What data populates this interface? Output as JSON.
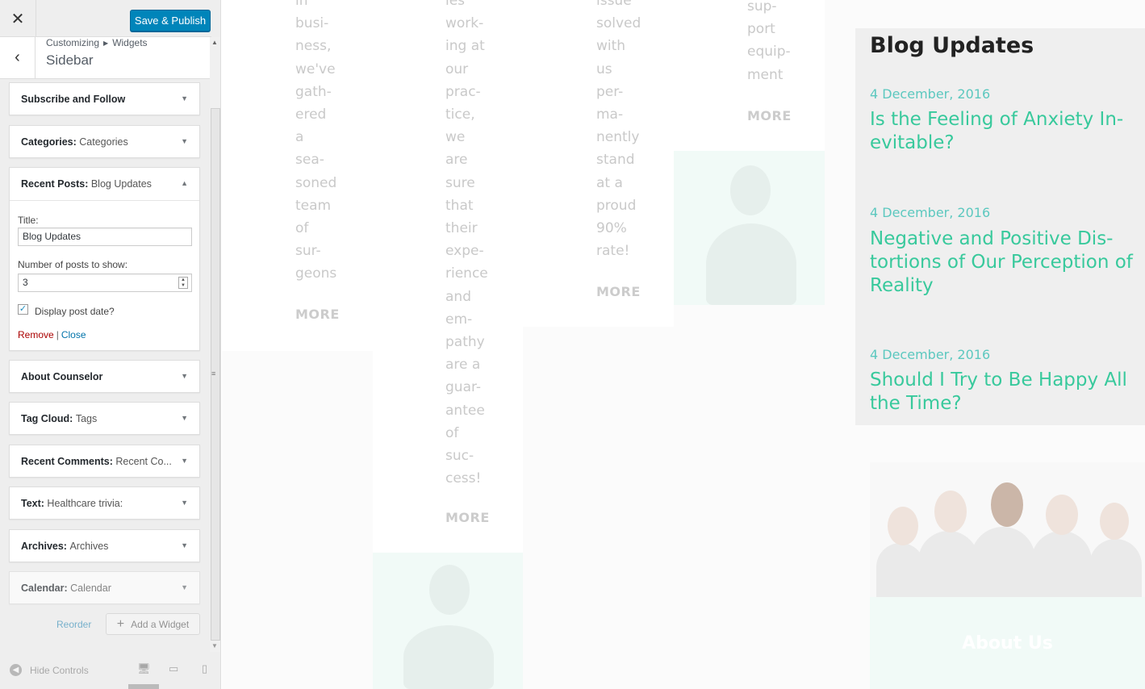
{
  "customizer": {
    "close_icon": "close-icon",
    "publish_label": "Save & Publish",
    "breadcrumb": [
      "Customizing",
      "Widgets"
    ],
    "section_title": "Sidebar",
    "widgets": [
      {
        "title": "Subscribe and Follow",
        "instance": ""
      },
      {
        "title": "Categories:",
        "instance": "Categories"
      },
      {
        "title": "About Counselor",
        "instance": ""
      },
      {
        "title": "Tag Cloud:",
        "instance": "Tags"
      },
      {
        "title": "Recent Comments:",
        "instance": "Recent Co..."
      },
      {
        "title": "Text:",
        "instance": "Healthcare trivia:"
      },
      {
        "title": "Archives:",
        "instance": "Archives"
      },
      {
        "title": "Calendar:",
        "instance": "Calendar"
      }
    ],
    "open_widget": {
      "title": "Recent Posts:",
      "instance": "Blog Updates",
      "title_label": "Title:",
      "title_value": "Blog Updates",
      "count_label": "Number of posts to show:",
      "count_value": "3",
      "date_label": "Display post date?",
      "date_checked": true,
      "remove_label": "Remove",
      "close_label": "Close"
    },
    "reorder_label": "Reorder",
    "add_widget_label": "Add a Widget",
    "hide_controls_label": "Hide Controls"
  },
  "preview": {
    "columns": [
      {
        "text": "in\nbusi-\nness,\nwe've\ngath-\nered\na\nsea-\nsoned\nteam\nof\nsur-\ngeons",
        "more": "MORE"
      },
      {
        "text": "ies\nwork-\ning at\nour\nprac-\ntice,\nwe\nare\nsure\nthat\ntheir\nexpe-\nrience\nand\nem-\npathy\nare a\nguar-\nantee\nof\nsuc-\ncess!",
        "more": "MORE"
      },
      {
        "text": "issue\nsolved\nwith\nus\nper-\nma-\nnently\nstand\nat a\nproud\n90%\nrate!",
        "more": "MORE"
      },
      {
        "text": "sup-\nport\nequip-\nment",
        "more": "MORE"
      }
    ],
    "blog": {
      "heading": "Blog Updates",
      "posts": [
        {
          "date": "4 December, 2016",
          "title": "Is the Feeling of Anxiety In-\nevitable?"
        },
        {
          "date": "4 December, 2016",
          "title": "Negative and Positive Dis-\ntortions of Our Perception of\nReality"
        },
        {
          "date": "4 December, 2016",
          "title": "Should I Try to Be Happy All\nthe Time?"
        }
      ]
    },
    "about_label": "About Us"
  },
  "colors": {
    "accent": "#0085ba",
    "post_title": "#38c99c",
    "post_date": "#5cc8bf",
    "remove_link": "#aa0000"
  }
}
